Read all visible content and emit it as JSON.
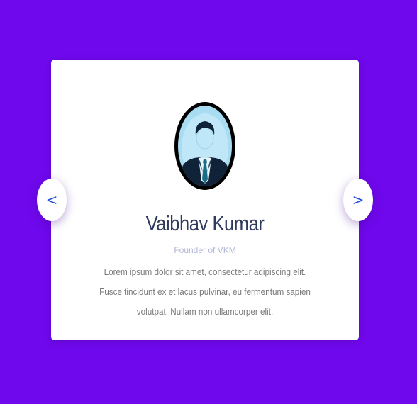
{
  "testimonial": {
    "name": "Vaibhav Kumar",
    "role": "Founder of VKM",
    "description": "Lorem ipsum dolor sit amet, consectetur adipiscing elit. Fusce tincidunt ex et lacus pulvinar, eu fermentum sapien volutpat. Nullam non ullamcorper elit.",
    "avatar_icon": "businessman-avatar-icon"
  },
  "navigation": {
    "prev_label": "<",
    "next_label": ">"
  },
  "colors": {
    "background": "#6f08ec",
    "card": "#ffffff",
    "name": "#2e3a5c",
    "role": "#b3b7d6",
    "arrow": "#1f4fd8"
  }
}
